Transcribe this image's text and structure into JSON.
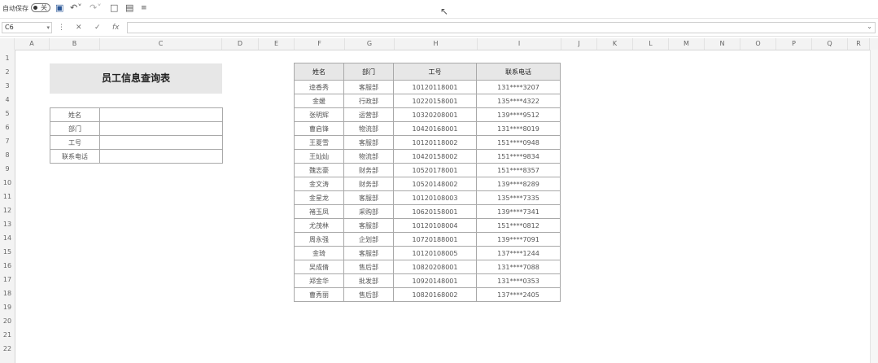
{
  "toolbar": {
    "autosave_label": "自动保存",
    "autosave_state": "关",
    "icons": [
      "save-icon",
      "undo-icon",
      "redo-icon",
      "new-file-icon",
      "print-preview-icon",
      "customize-icon"
    ]
  },
  "formula_bar": {
    "name_box": "C6",
    "formula": ""
  },
  "columns": [
    "A",
    "B",
    "C",
    "D",
    "E",
    "F",
    "G",
    "H",
    "I",
    "J",
    "K",
    "L",
    "M",
    "N",
    "O",
    "P",
    "Q",
    "R"
  ],
  "rows": [
    "1",
    "2",
    "3",
    "4",
    "5",
    "6",
    "7",
    "8",
    "9",
    "10",
    "11",
    "12",
    "13",
    "14",
    "15",
    "16",
    "17",
    "18",
    "19",
    "20",
    "21",
    "22"
  ],
  "query_form": {
    "title": "员工信息查询表",
    "fields": [
      "姓名",
      "部门",
      "工号",
      "联系电话"
    ]
  },
  "employee_table": {
    "headers": [
      "姓名",
      "部门",
      "工号",
      "联系电话"
    ],
    "rows": [
      [
        "逵香秀",
        "客服部",
        "10120118001",
        "131****3207"
      ],
      [
        "金媛",
        "行政部",
        "10220158001",
        "135****4322"
      ],
      [
        "张明辉",
        "运营部",
        "10320208001",
        "139****9512"
      ],
      [
        "曹启锋",
        "物流部",
        "10420168001",
        "131****8019"
      ],
      [
        "王夏雪",
        "客服部",
        "10120118002",
        "151****0948"
      ],
      [
        "王灿灿",
        "物流部",
        "10420158002",
        "151****9834"
      ],
      [
        "魏志豪",
        "财务部",
        "10520178001",
        "151****8357"
      ],
      [
        "金文涛",
        "财务部",
        "10520148002",
        "139****8289"
      ],
      [
        "金星龙",
        "客服部",
        "10120108003",
        "135****7335"
      ],
      [
        "褚玉凤",
        "采购部",
        "10620158001",
        "139****7341"
      ],
      [
        "尤茂林",
        "客服部",
        "10120108004",
        "151****0812"
      ],
      [
        "周永强",
        "企划部",
        "10720188001",
        "139****7091"
      ],
      [
        "金琦",
        "客服部",
        "10120108005",
        "137****1244"
      ],
      [
        "吴成倩",
        "售后部",
        "10820208001",
        "131****7088"
      ],
      [
        "郑金华",
        "批发部",
        "10920148001",
        "131****0353"
      ],
      [
        "曹秀丽",
        "售后部",
        "10820168002",
        "137****2405"
      ]
    ]
  }
}
